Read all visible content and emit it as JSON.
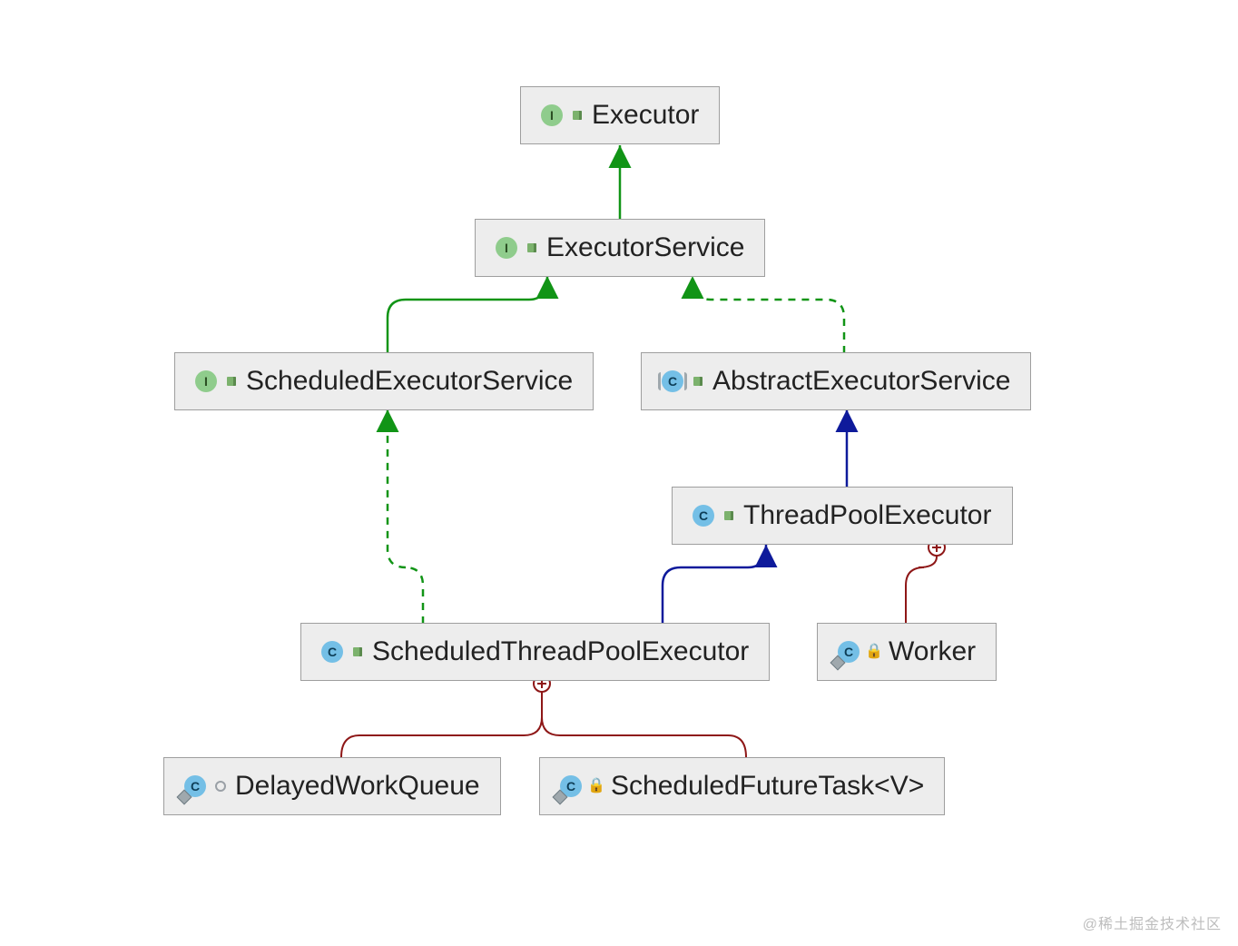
{
  "watermark": "@稀土掘金技术社区",
  "nodes": {
    "executor": {
      "label": "Executor",
      "type_letter": "I"
    },
    "executorService": {
      "label": "ExecutorService",
      "type_letter": "I"
    },
    "schedExecService": {
      "label": "ScheduledExecutorService",
      "type_letter": "I"
    },
    "absExecService": {
      "label": "AbstractExecutorService",
      "type_letter": "C"
    },
    "threadPoolExec": {
      "label": "ThreadPoolExecutor",
      "type_letter": "C"
    },
    "schedTPExec": {
      "label": "ScheduledThreadPoolExecutor",
      "type_letter": "C"
    },
    "worker": {
      "label": "Worker",
      "type_letter": "C"
    },
    "delayedWQ": {
      "label": "DelayedWorkQueue",
      "type_letter": "C"
    },
    "schedFutureTask": {
      "label": "ScheduledFutureTask<V>",
      "type_letter": "C"
    }
  },
  "chart_data": {
    "type": "class-hierarchy",
    "classes": [
      {
        "id": "Executor",
        "kind": "interface",
        "visibility": "public"
      },
      {
        "id": "ExecutorService",
        "kind": "interface",
        "visibility": "public"
      },
      {
        "id": "ScheduledExecutorService",
        "kind": "interface",
        "visibility": "public"
      },
      {
        "id": "AbstractExecutorService",
        "kind": "abstract-class",
        "visibility": "public"
      },
      {
        "id": "ThreadPoolExecutor",
        "kind": "class",
        "visibility": "public"
      },
      {
        "id": "ScheduledThreadPoolExecutor",
        "kind": "class",
        "visibility": "public"
      },
      {
        "id": "Worker",
        "kind": "class",
        "visibility": "private",
        "outer": "ThreadPoolExecutor"
      },
      {
        "id": "DelayedWorkQueue",
        "kind": "class",
        "visibility": "package-private",
        "outer": "ScheduledThreadPoolExecutor"
      },
      {
        "id": "ScheduledFutureTask<V>",
        "kind": "class",
        "visibility": "private",
        "outer": "ScheduledThreadPoolExecutor"
      }
    ],
    "edges": [
      {
        "from": "ExecutorService",
        "to": "Executor",
        "rel": "extends-interface",
        "style": "solid-green"
      },
      {
        "from": "ScheduledExecutorService",
        "to": "ExecutorService",
        "rel": "extends-interface",
        "style": "solid-green"
      },
      {
        "from": "AbstractExecutorService",
        "to": "ExecutorService",
        "rel": "implements",
        "style": "dashed-green"
      },
      {
        "from": "ThreadPoolExecutor",
        "to": "AbstractExecutorService",
        "rel": "extends-class",
        "style": "solid-blue"
      },
      {
        "from": "ScheduledThreadPoolExecutor",
        "to": "ThreadPoolExecutor",
        "rel": "extends-class",
        "style": "solid-blue"
      },
      {
        "from": "ScheduledThreadPoolExecutor",
        "to": "ScheduledExecutorService",
        "rel": "implements",
        "style": "dashed-green"
      },
      {
        "from": "Worker",
        "to": "ThreadPoolExecutor",
        "rel": "inner-class",
        "style": "solid-darkred-plus"
      },
      {
        "from": "DelayedWorkQueue",
        "to": "ScheduledThreadPoolExecutor",
        "rel": "inner-class",
        "style": "solid-darkred-plus"
      },
      {
        "from": "ScheduledFutureTask<V>",
        "to": "ScheduledThreadPoolExecutor",
        "rel": "inner-class",
        "style": "solid-darkred-plus"
      }
    ]
  }
}
